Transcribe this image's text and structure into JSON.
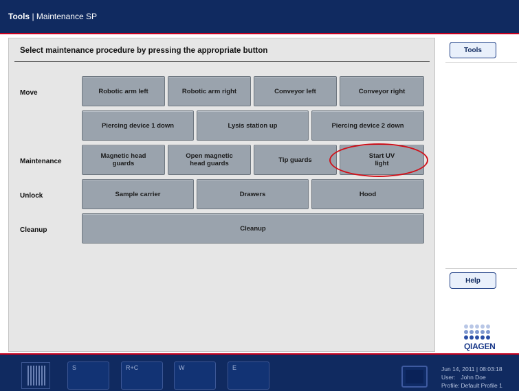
{
  "title": {
    "section": "Tools",
    "separator": " | ",
    "subtitle": "Maintenance SP"
  },
  "instruction": "Select maintenance procedure by pressing the appropriate button",
  "rows": {
    "move": "Move",
    "maintenance": "Maintenance",
    "unlock": "Unlock",
    "cleanup": "Cleanup"
  },
  "buttons": {
    "robotic_arm_left": "Robotic arm left",
    "robotic_arm_right": "Robotic arm right",
    "conveyor_left": "Conveyor left",
    "conveyor_right": "Conveyor right",
    "piercing_device_1_down": "Piercing device 1 down",
    "lysis_station_up": "Lysis station up",
    "piercing_device_2_down": "Piercing device 2 down",
    "magnetic_head_guards": "Magnetic head guards",
    "open_magnetic_head_guards": "Open magnetic head guards",
    "tip_guards": "Tip guards",
    "start_uv_light": "Start UV light",
    "sample_carrier": "Sample carrier",
    "drawers": "Drawers",
    "hood": "Hood",
    "cleanup": "Cleanup"
  },
  "side": {
    "tools": "Tools",
    "help": "Help",
    "logo_text": "QIAGEN"
  },
  "slots": {
    "s": "S",
    "rc": "R+C",
    "w": "W",
    "e": "E"
  },
  "status": {
    "datetime": "Jun 14, 2011 | 08:03:18",
    "user_label": "User:",
    "user": "John Doe",
    "profile_label": "Profile:",
    "profile": "Default Profile 1"
  },
  "colors": {
    "header": "#102a60",
    "accent_red": "#c8001e",
    "button": "#9aa3ad",
    "highlight_circle": "#d0121b"
  }
}
